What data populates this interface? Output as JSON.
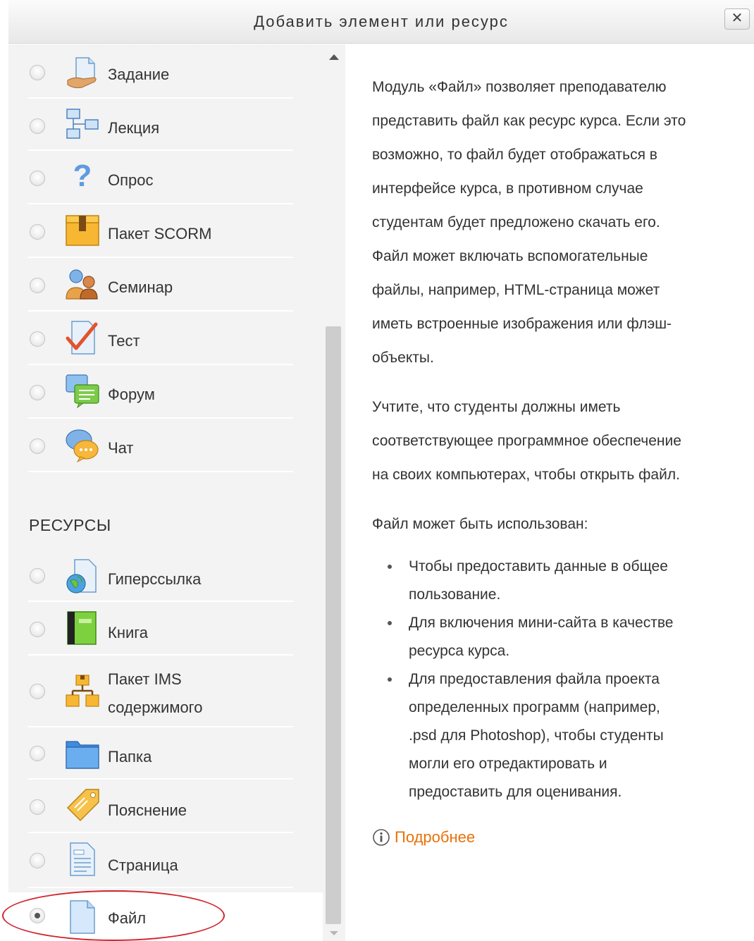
{
  "dialog": {
    "title": "Добавить элемент или ресурс",
    "close_label": "✕"
  },
  "activities": [
    {
      "label": "Задание",
      "icon": "assignment-icon",
      "selected": false
    },
    {
      "label": "Лекция",
      "icon": "lesson-icon",
      "selected": false
    },
    {
      "label": "Опрос",
      "icon": "question-icon",
      "selected": false
    },
    {
      "label": "Пакет SCORM",
      "icon": "scorm-package-icon",
      "selected": false
    },
    {
      "label": "Семинар",
      "icon": "workshop-icon",
      "selected": false
    },
    {
      "label": "Тест",
      "icon": "quiz-icon",
      "selected": false
    },
    {
      "label": "Форум",
      "icon": "forum-icon",
      "selected": false
    },
    {
      "label": "Чат",
      "icon": "chat-icon",
      "selected": false
    }
  ],
  "resources_heading": "РЕСУРСЫ",
  "resources": [
    {
      "label": "Гиперссылка",
      "icon": "url-icon",
      "selected": false
    },
    {
      "label": "Книга",
      "icon": "book-icon",
      "selected": false
    },
    {
      "label": "Пакет IMS",
      "label2": "содержимого",
      "icon": "ims-package-icon",
      "selected": false
    },
    {
      "label": "Папка",
      "icon": "folder-icon",
      "selected": false
    },
    {
      "label": "Пояснение",
      "icon": "label-tag-icon",
      "selected": false
    },
    {
      "label": "Страница",
      "icon": "page-icon",
      "selected": false
    },
    {
      "label": "Файл",
      "icon": "file-icon",
      "selected": true
    }
  ],
  "help": {
    "lines1": [
      "Модуль «Файл» позволяет преподавателю",
      "представить файл как ресурс курса. Если это",
      "возможно, то файл будет отображаться в",
      "интерфейсе курса, в противном случае",
      "студентам будет предложено скачать его.",
      "Файл может включать вспомогательные",
      "файлы, например, HTML-страница может",
      "иметь встроенные изображения или флэш-",
      "объекты."
    ],
    "lines2": [
      "Учтите, что студенты должны иметь",
      "соответствующее программное обеспечение",
      "на своих компьютерах, чтобы открыть файл."
    ],
    "usage_intro": "Файл может быть использован:",
    "usage_items": [
      [
        "Чтобы предоставить данные в общее",
        "пользование."
      ],
      [
        "Для включения мини-сайта в качестве",
        "ресурса курса."
      ],
      [
        "Для предоставления файла проекта",
        "определенных программ (например,",
        ".psd для Photoshop), чтобы студенты",
        "могли его отредактировать и",
        "предоставить для оценивания."
      ]
    ],
    "more_link": "Подробнее"
  },
  "colors": {
    "link": "#e8710a",
    "highlight": "#d0262e",
    "pane_bg": "#f3f3f3"
  }
}
